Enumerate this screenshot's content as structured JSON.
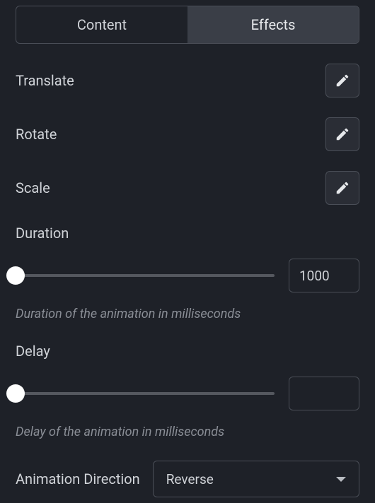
{
  "tabs": {
    "content": "Content",
    "effects": "Effects"
  },
  "props": {
    "translate": "Translate",
    "rotate": "Rotate",
    "scale": "Scale"
  },
  "duration": {
    "label": "Duration",
    "value": "1000",
    "helper": "Duration of the animation in milliseconds"
  },
  "delay": {
    "label": "Delay",
    "value": "",
    "helper": "Delay of the animation in milliseconds"
  },
  "direction": {
    "label": "Animation Direction",
    "selected": "Reverse"
  }
}
